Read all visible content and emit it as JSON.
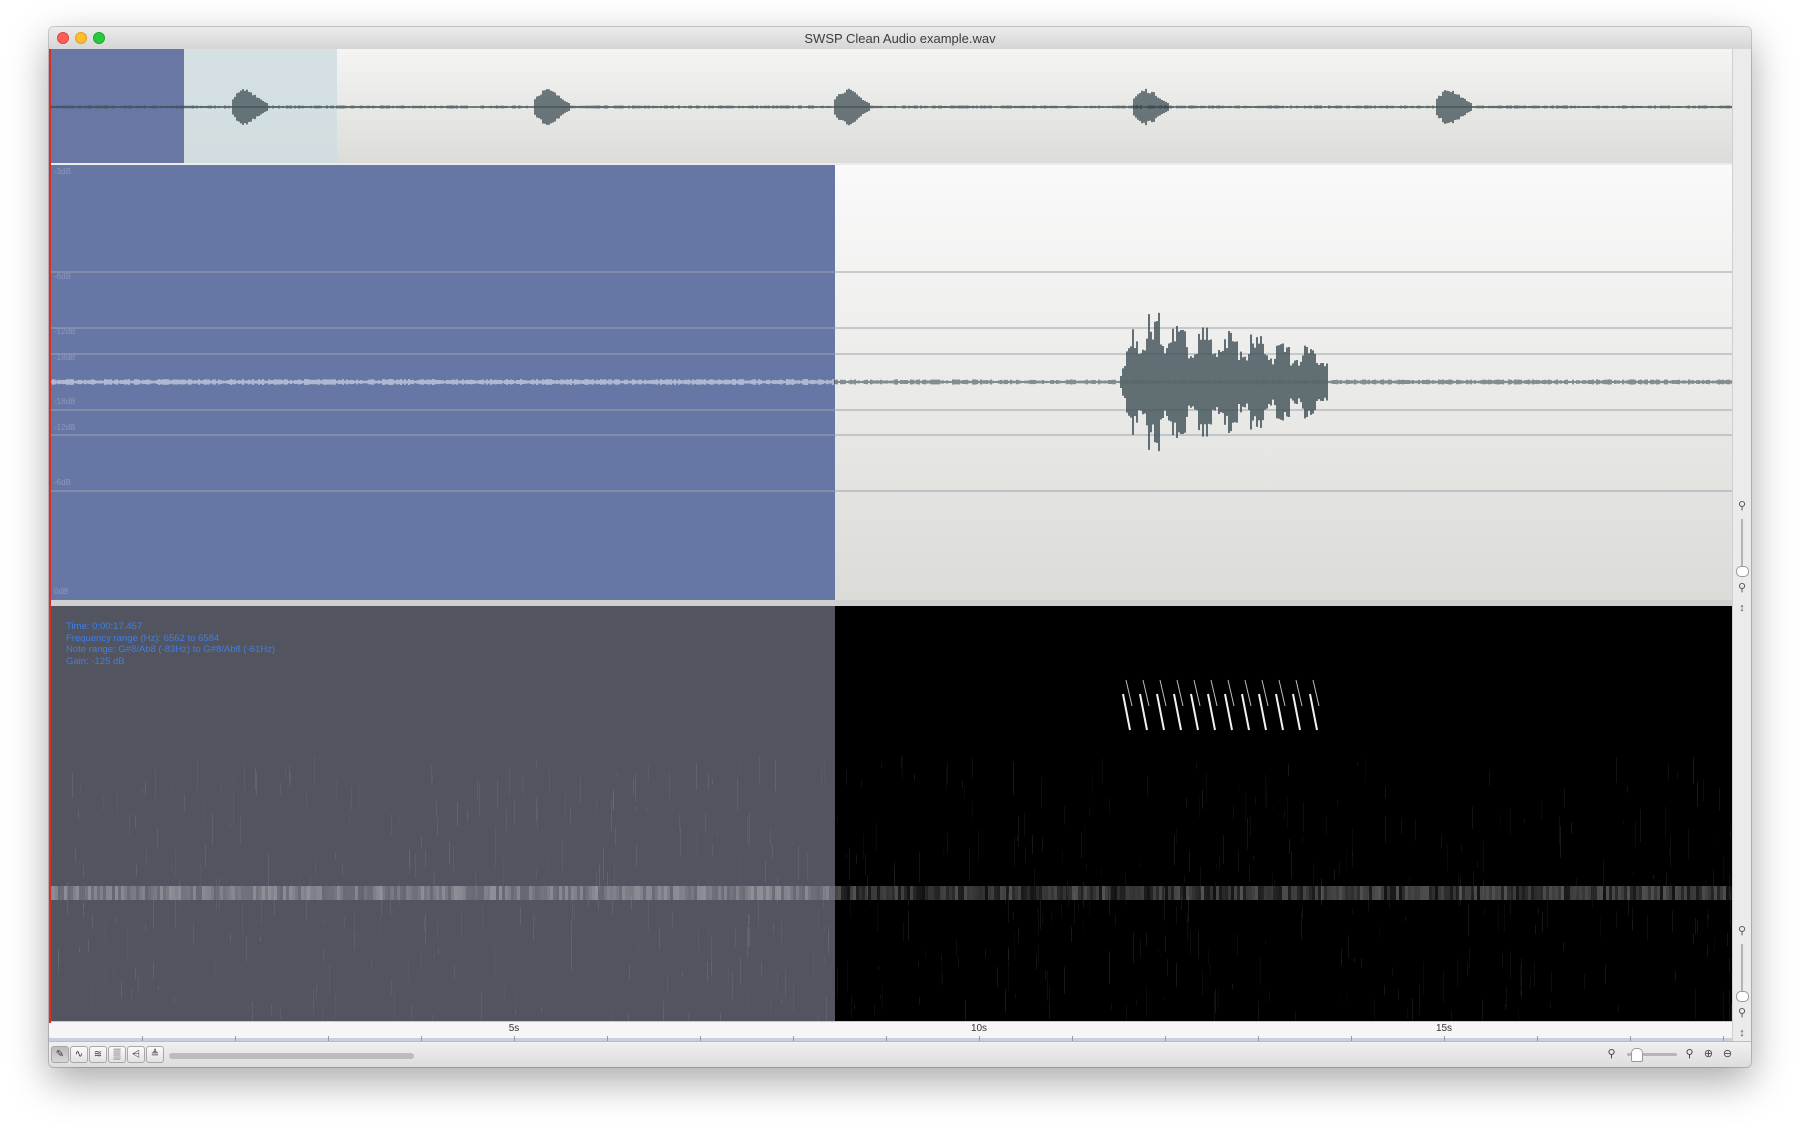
{
  "window": {
    "title": "SWSP Clean Audio example.wav"
  },
  "spectrogram_info": {
    "time": "Time: 0:00:17.457",
    "frequency_range": "Frequency range (Hz): 6562 to 6584",
    "note_range": "Note range: G#8/Ab8 (-83Hz) to G#8/Ab8 (-61Hz)",
    "gain": "Gain: -125 dB"
  },
  "waveform_scale": {
    "labels": [
      "-3dB",
      "-6dB",
      "-12dB",
      "-18dB",
      "-18dB",
      "-12dB",
      "-6dB",
      "0dB"
    ]
  },
  "ruler": {
    "ticks": [
      "5s",
      "10s",
      "15s"
    ]
  },
  "toolbar": {
    "tools": [
      {
        "name": "draw-tool",
        "glyph": "✎"
      },
      {
        "name": "waveform-tool",
        "glyph": "∿"
      },
      {
        "name": "waveform-stereo-tool",
        "glyph": "≋"
      },
      {
        "name": "spectrogram-tool",
        "glyph": "▒"
      },
      {
        "name": "level-tool",
        "glyph": "⩤"
      },
      {
        "name": "level-alt-tool",
        "glyph": "≜"
      }
    ]
  },
  "colors": {
    "selection": "#6777a5",
    "waveform": "#3f4f55",
    "spec_info_text": "#3f7ee6",
    "playhead": "#e02a2a"
  }
}
